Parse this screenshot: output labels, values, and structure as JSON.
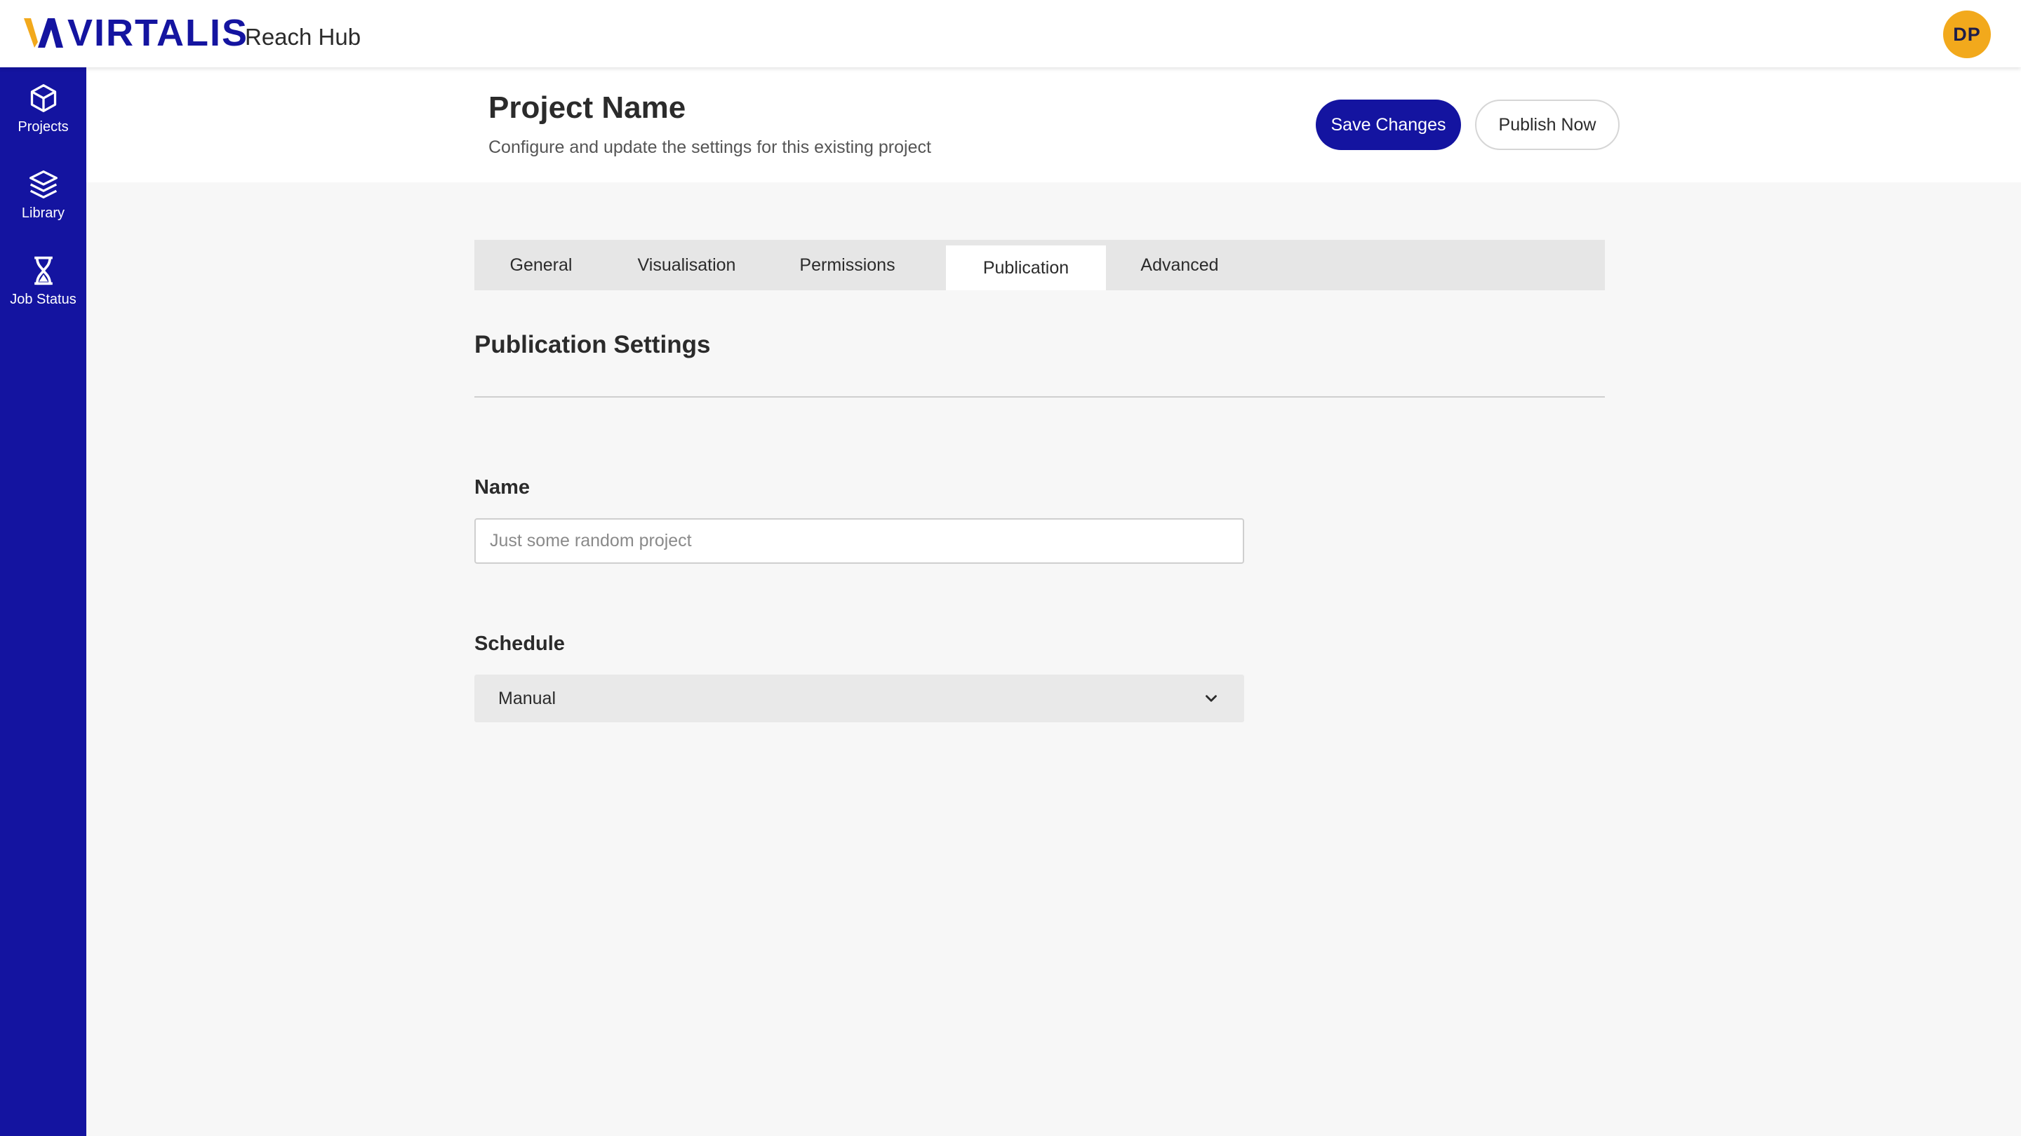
{
  "brand": {
    "logo_text": "VIRTALIS",
    "app_name": "Reach Hub",
    "logo_colors": {
      "mark_accent": "#f2a91c",
      "primary": "#1414a0"
    }
  },
  "user": {
    "initials": "DP",
    "avatar_color": "#f2a91c"
  },
  "sidenav": {
    "items": [
      {
        "label": "Projects",
        "icon": "cube-icon"
      },
      {
        "label": "Library",
        "icon": "layers-icon"
      },
      {
        "label": "Job Status",
        "icon": "hourglass-icon"
      }
    ]
  },
  "header": {
    "title": "Project Name",
    "subtitle": "Configure and update the settings for this existing project",
    "save_label": "Save Changes",
    "publish_label": "Publish Now"
  },
  "tabs": [
    {
      "label": "General",
      "active": false
    },
    {
      "label": "Visualisation",
      "active": false
    },
    {
      "label": "Permissions",
      "active": false
    },
    {
      "label": "Publication",
      "active": true
    },
    {
      "label": "Advanced",
      "active": false
    }
  ],
  "section": {
    "title": "Publication Settings",
    "name_label": "Name",
    "name_placeholder": "Just some random project",
    "name_value": "",
    "schedule_label": "Schedule",
    "schedule_value": "Manual"
  },
  "colors": {
    "primary": "#1414a0",
    "accent": "#f2a91c",
    "background": "#f7f7f7"
  }
}
